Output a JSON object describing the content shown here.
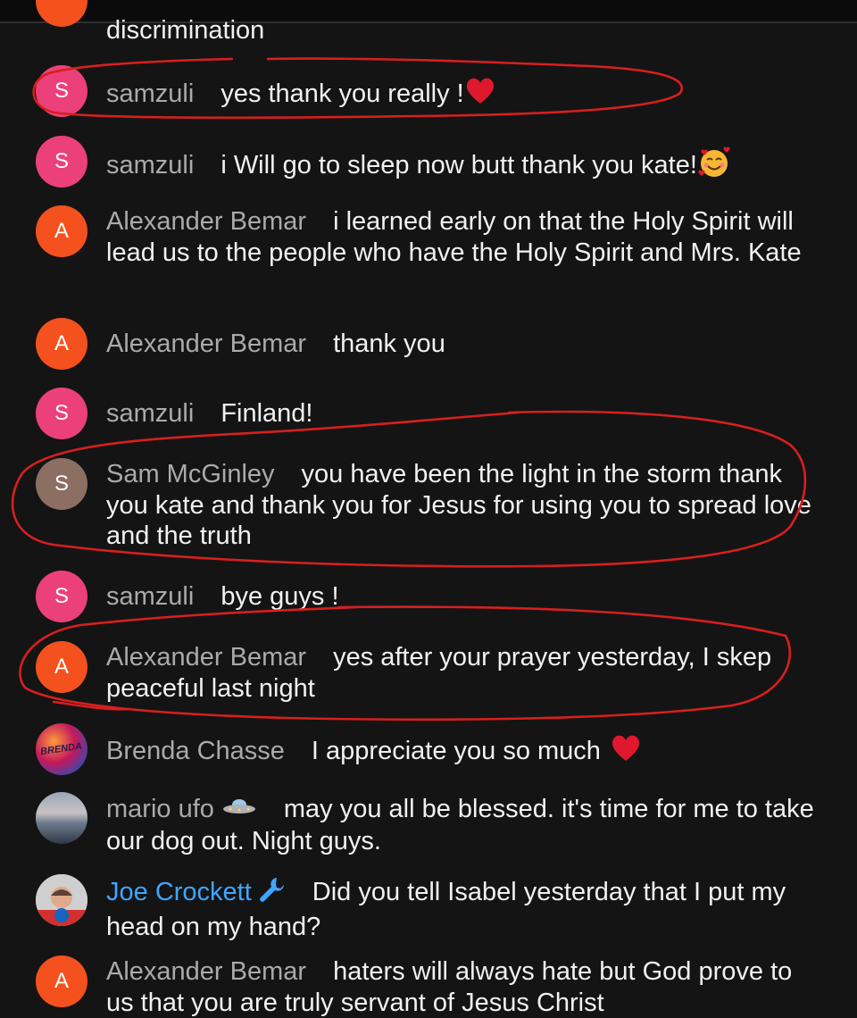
{
  "colors": {
    "background": "#141414",
    "author_name": "#aaaaaa",
    "moderator_name": "#3ea6ff",
    "message_text": "#f1f1f1",
    "annotation": "#d81f1f"
  },
  "messages": [
    {
      "avatar": "",
      "author": "",
      "text": "discrimination"
    },
    {
      "avatar": "S",
      "author": "samzuli",
      "text": "yes thank you really !",
      "emoji": "heart-icon"
    },
    {
      "avatar": "S",
      "author": "samzuli",
      "text": "i Will go to sleep now butt thank you kate!",
      "emoji": "smiling-face-with-hearts-icon"
    },
    {
      "avatar": "A",
      "author": "Alexander Bemar",
      "text": "i learned early on that the Holy Spirit will lead us to the people who have the Holy Spirit and Mrs. Kate"
    },
    {
      "avatar": "A",
      "author": "Alexander Bemar",
      "text": "thank you"
    },
    {
      "avatar": "S",
      "author": "samzuli",
      "text": "Finland!"
    },
    {
      "avatar": "S",
      "author": "Sam McGinley",
      "text": "you have been the light in the storm thank you kate and thank you for Jesus for using you to spread love and the truth"
    },
    {
      "avatar": "S",
      "author": "samzuli",
      "text": "bye guys !"
    },
    {
      "avatar": "A",
      "author": "Alexander Bemar",
      "text": "yes after your prayer yesterday, I skep peaceful last night"
    },
    {
      "avatar": "BRENDA",
      "author": "Brenda Chasse",
      "text": "I appreciate you so much",
      "emoji": "heart-icon"
    },
    {
      "avatar": "",
      "author": "mario ufo",
      "author_emoji": "ufo-icon",
      "text": "may you all be blessed. it's time for me to take our dog out. Night guys."
    },
    {
      "avatar": "",
      "author": "Joe Crockett",
      "author_emoji": "wrench-icon",
      "text": "Did you tell Isabel yesterday that I put my head on my hand?"
    },
    {
      "avatar": "A",
      "author": "Alexander Bemar",
      "text": "haters will always hate but God prove to us that you are truly servant of Jesus Christ"
    }
  ]
}
